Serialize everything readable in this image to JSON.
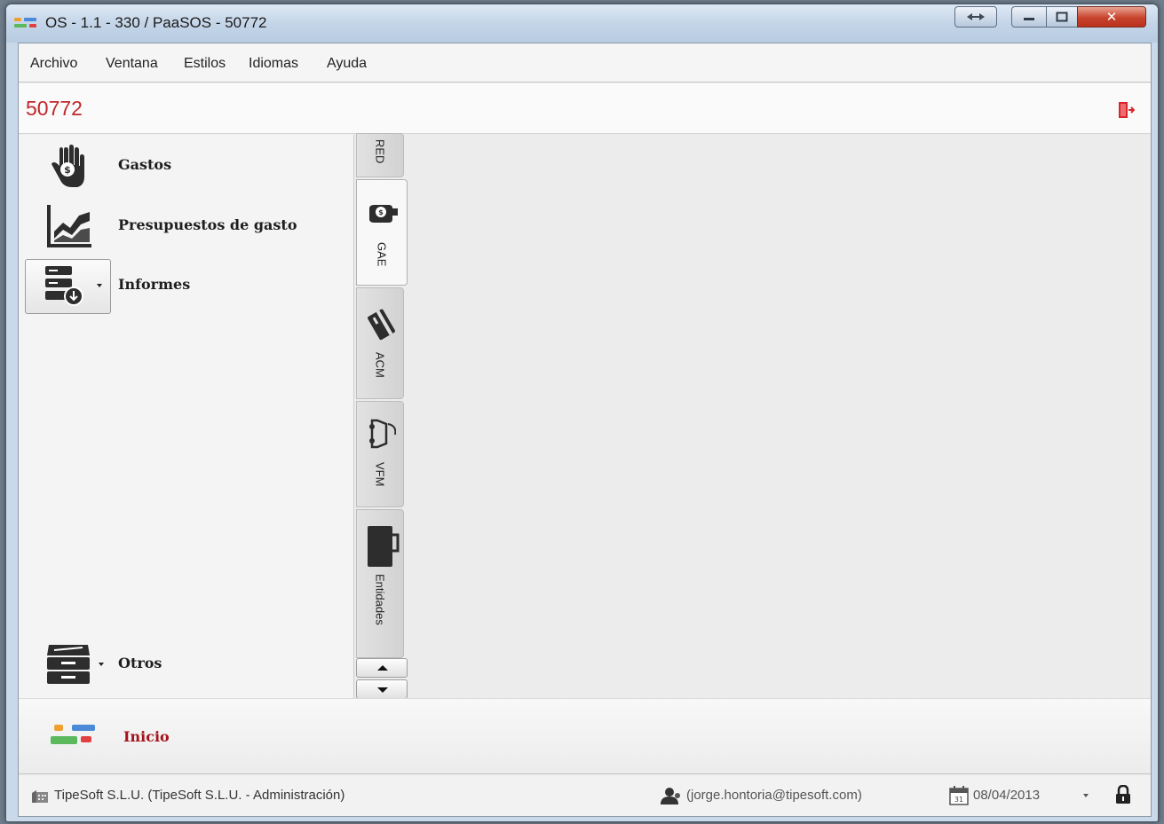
{
  "window": {
    "title": "OS - 1.1 - 330 / PaaSOS - 50772"
  },
  "menu": {
    "items": [
      "Archivo",
      "Ventana",
      "Estilos",
      "Idiomas",
      "Ayuda"
    ]
  },
  "header": {
    "title": "50772"
  },
  "sidebar": {
    "items": [
      {
        "label": "Gastos",
        "icon": "hand-money-icon"
      },
      {
        "label": "Presupuestos de gasto",
        "icon": "chart-icon"
      },
      {
        "label": "Informes",
        "icon": "report-download-icon"
      }
    ],
    "footer_item": {
      "label": "Otros",
      "icon": "archive-icon"
    }
  },
  "tabs": [
    {
      "label": "RED",
      "icon": null
    },
    {
      "label": "GAE",
      "icon": "hand-money-icon",
      "active": true
    },
    {
      "label": "ACM",
      "icon": "card-icon"
    },
    {
      "label": "VFM",
      "icon": "car-key-icon"
    },
    {
      "label": "Entidades",
      "icon": "briefcase-icon"
    }
  ],
  "bottom": {
    "inicio_label": "Inicio"
  },
  "status": {
    "company": "TipeSoft S.L.U. (TipeSoft S.L.U. - Administración)",
    "user": "(jorge.hontoria@tipesoft.com)",
    "date": "08/04/2013"
  },
  "colors": {
    "accent_red": "#c0282d",
    "logo_blue": "#4a8ad8",
    "logo_green": "#5cb85c",
    "logo_red": "#e04040",
    "logo_orange": "#f0a030"
  }
}
